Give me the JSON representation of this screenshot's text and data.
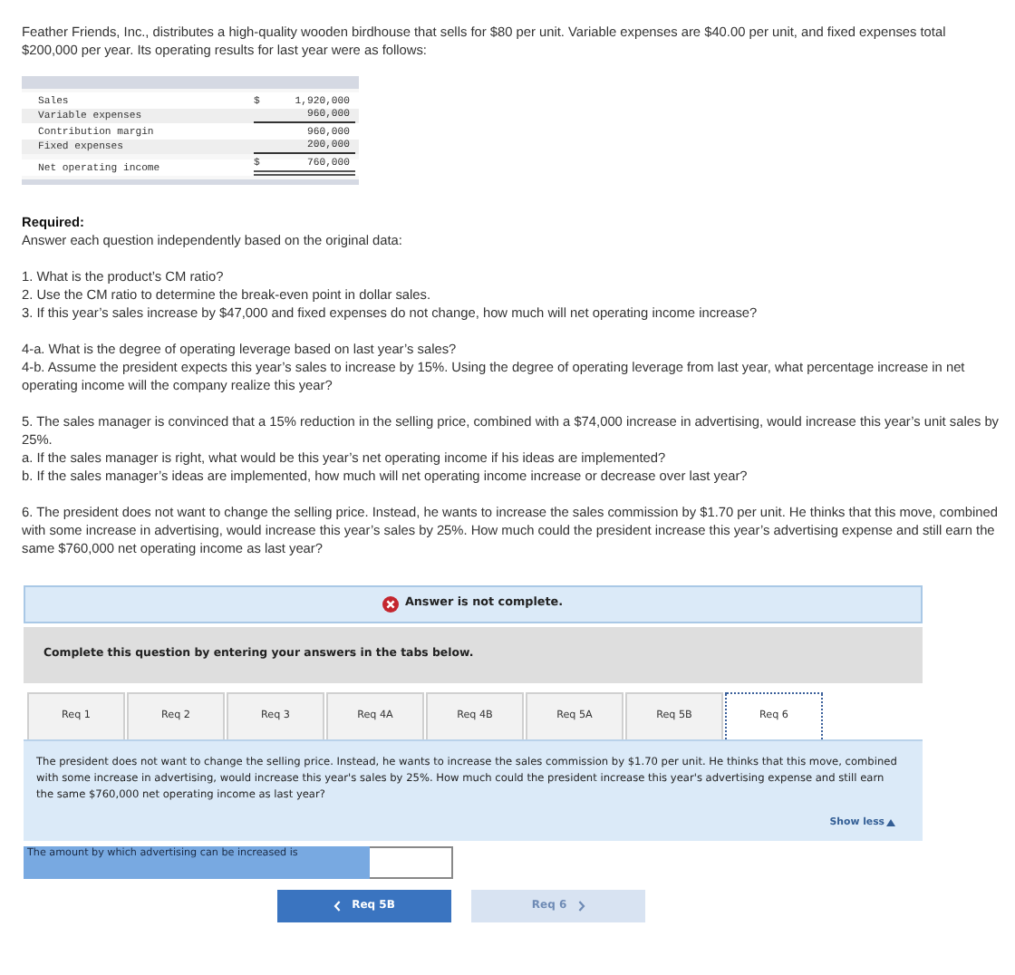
{
  "intro": "Feather Friends, Inc., distributes a high-quality wooden birdhouse that sells for $80 per unit. Variable expenses are $40.00 per unit, and fixed expenses total $200,000 per year. Its operating results for last year were as follows:",
  "income_statement": [
    {
      "label": "Sales",
      "currency": "$",
      "value": "1,920,000",
      "underlined": false
    },
    {
      "label": "Variable expenses",
      "value": "960,000",
      "underlined": true
    },
    {
      "label": "Contribution margin",
      "value": "960,000",
      "underlined": false
    },
    {
      "label": "Fixed expenses",
      "value": "200,000",
      "underlined": true
    },
    {
      "label": "Net operating income",
      "currency": "$",
      "value": "760,000",
      "underlined": true,
      "total": true
    }
  ],
  "required": {
    "heading": "Required:",
    "instruction": "Answer each question independently based on the original data:",
    "question_groups": [
      [
        "1. What is the product’s CM ratio?",
        "2. Use the CM ratio to determine the break-even point in dollar sales.",
        "3. If this year’s sales increase by $47,000 and fixed expenses do not change, how much will net operating income increase?"
      ],
      [
        "4-a. What is the degree of operating leverage based on last year’s sales?",
        "4-b. Assume the president expects this year’s sales to increase by 15%. Using the degree of operating leverage from last year, what percentage increase in net operating income will the company realize this year?"
      ],
      [
        "5. The sales manager is convinced that a 15% reduction in the selling price, combined with a $74,000 increase in advertising, would increase this year’s unit sales by 25%.",
        "a. If the sales manager is right, what would be this year’s net operating income if his ideas are implemented?",
        "b. If the sales manager’s ideas are implemented, how much will net operating income increase or decrease over last year?"
      ],
      [
        "6. The president does not want to change the selling price. Instead, he wants to increase the sales commission by $1.70 per unit. He thinks that this move, combined with some increase in advertising, would increase this year’s sales by 25%. How much could the president increase this year’s advertising expense and still earn the same $760,000 net operating income as last year?"
      ]
    ]
  },
  "alert": "Answer is not complete.",
  "tabs_instruction": "Complete this question by entering your answers in the tabs below.",
  "tabs": [
    {
      "label": "Req 1",
      "selected": false
    },
    {
      "label": "Req 2",
      "selected": false
    },
    {
      "label": "Req 3",
      "selected": false
    },
    {
      "label": "Req 4A",
      "selected": false
    },
    {
      "label": "Req 4B",
      "selected": false
    },
    {
      "label": "Req 5A",
      "selected": false
    },
    {
      "label": "Req 5B",
      "selected": false
    },
    {
      "label": "Req 6",
      "selected": true
    }
  ],
  "tab_question": "The president does not want to change the selling price. Instead, he wants to increase the sales commission by $1.70 per unit. He thinks that this move, combined with some increase in advertising, would increase this year's sales by 25%. How much could the president increase this year's advertising expense and still earn the same $760,000 net operating income as last year?",
  "show_less": "Show less",
  "answer": {
    "label": "The amount by which advertising can be increased is"
  },
  "prev_button": {
    "label": "Req 5B",
    "disabled": false
  },
  "next_button": {
    "label": "Req 6",
    "disabled": true
  }
}
